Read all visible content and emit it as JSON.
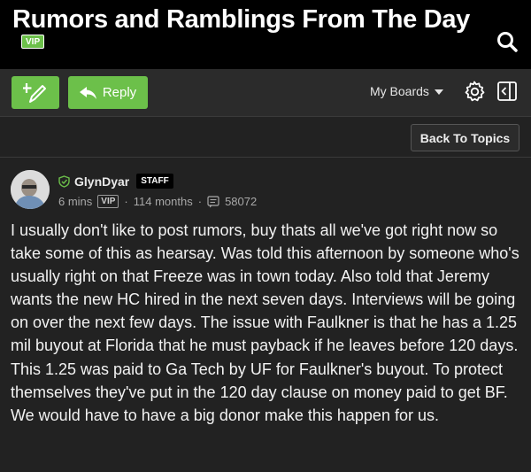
{
  "header": {
    "title": "Rumors and Ramblings From The Day",
    "vip_badge": "VIP",
    "search_icon": "search-icon"
  },
  "toolbar": {
    "new_post_icon": "new-post-icon",
    "reply_label": "Reply",
    "my_boards_label": "My Boards",
    "gear_icon": "gear-icon",
    "collapse_icon": "collapse-sidebar-icon"
  },
  "subbar": {
    "back_label": "Back To Topics"
  },
  "post": {
    "username": "GlynDyar",
    "staff_badge": "STAFF",
    "time_ago": "6 mins",
    "vip_badge": "VIP",
    "member_duration": "114 months",
    "post_count": "58072",
    "body": "I usually don't like to post rumors, buy thats all we've got right now so take some of this as hearsay. Was told this afternoon by someone who's usually right on that Freeze was in town today. Also told that Jeremy wants the new HC hired in the next seven days. Interviews will be going on over the next few days. The issue with Faulkner is that he has a 1.25 mil buyout at Florida that he must payback if he leaves before 120 days. This 1.25 was paid to Ga Tech by UF for Faulkner's buyout. To protect themselves they've put in the 120 day clause on money paid to get BF. We would have to have a big donor make this happen for us."
  },
  "colors": {
    "accent_green": "#6cc04a",
    "header_bg": "#000000",
    "page_bg": "#222222"
  }
}
